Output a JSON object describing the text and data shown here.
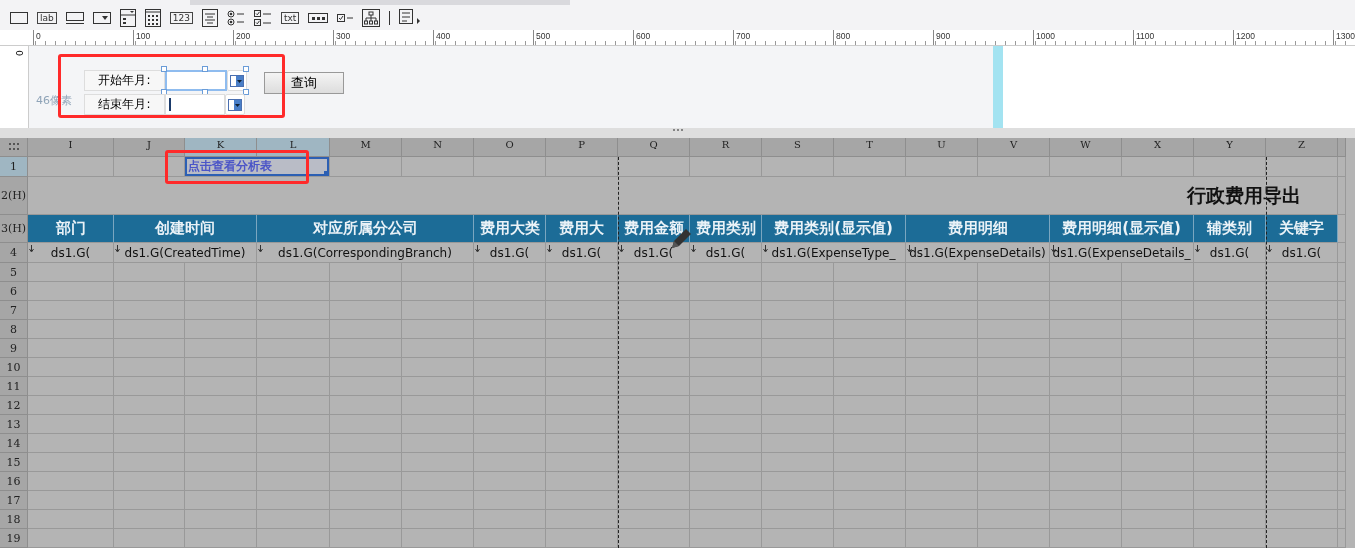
{
  "toolbar": [
    {
      "kind": "frame"
    },
    {
      "kind": "text",
      "text": "lab"
    },
    {
      "kind": "textbox"
    },
    {
      "kind": "combo"
    },
    {
      "kind": "list"
    },
    {
      "kind": "calendar"
    },
    {
      "kind": "text",
      "text": "123"
    },
    {
      "kind": "textarea"
    },
    {
      "kind": "radio"
    },
    {
      "kind": "checkgroup"
    },
    {
      "kind": "text",
      "text": "txt"
    },
    {
      "kind": "password"
    },
    {
      "kind": "checkbox"
    },
    {
      "kind": "tree"
    },
    {
      "kind": "separator"
    },
    {
      "kind": "more"
    }
  ],
  "ruler": {
    "ticks": [
      "0",
      "100",
      "200",
      "300",
      "400",
      "500",
      "600",
      "700",
      "800",
      "900",
      "1000",
      "1100",
      "1200",
      "1300"
    ],
    "vertical": "0"
  },
  "parameters": {
    "height_hint": "46像素",
    "button": "查询",
    "fields": [
      {
        "label": "开始年月:",
        "selected": true,
        "cursor": false
      },
      {
        "label": "结束年月:",
        "selected": false,
        "cursor": true
      }
    ]
  },
  "sheet": {
    "columns": [
      {
        "letter": "I",
        "selected": false,
        "page_break_after": false
      },
      {
        "letter": "J",
        "selected": false,
        "page_break_after": false
      },
      {
        "letter": "K",
        "selected": true,
        "page_break_after": false
      },
      {
        "letter": "L",
        "selected": true,
        "page_break_after": false
      },
      {
        "letter": "M",
        "selected": false,
        "page_break_after": false
      },
      {
        "letter": "N",
        "selected": false,
        "page_break_after": false
      },
      {
        "letter": "O",
        "selected": false,
        "page_break_after": false
      },
      {
        "letter": "P",
        "selected": false,
        "page_break_after": true
      },
      {
        "letter": "Q",
        "selected": false,
        "page_break_after": false
      },
      {
        "letter": "R",
        "selected": false,
        "page_break_after": false
      },
      {
        "letter": "S",
        "selected": false,
        "page_break_after": false
      },
      {
        "letter": "T",
        "selected": false,
        "page_break_after": false
      },
      {
        "letter": "U",
        "selected": false,
        "page_break_after": false
      },
      {
        "letter": "V",
        "selected": false,
        "page_break_after": false
      },
      {
        "letter": "W",
        "selected": false,
        "page_break_after": false
      },
      {
        "letter": "X",
        "selected": false,
        "page_break_after": false
      },
      {
        "letter": "Y",
        "selected": false,
        "page_break_after": true
      },
      {
        "letter": "Z",
        "selected": false,
        "page_break_after": false
      }
    ],
    "rows": [
      {
        "label": "1",
        "selected": true,
        "cells": [
          {
            "kind": "empty"
          },
          {
            "kind": "empty"
          },
          {
            "kind": "link",
            "text": "点击查看分析表",
            "selected": true
          },
          {
            "kind": "merged"
          }
        ]
      },
      {
        "label": "2(H)",
        "selected": false,
        "cells": [
          {
            "kind": "title",
            "text": "行政费用导出"
          },
          {
            "kind": "merged"
          },
          {
            "kind": "merged"
          },
          {
            "kind": "merged"
          },
          {
            "kind": "merged"
          },
          {
            "kind": "merged"
          },
          {
            "kind": "merged"
          },
          {
            "kind": "merged"
          },
          {
            "kind": "merged"
          },
          {
            "kind": "merged"
          },
          {
            "kind": "merged"
          },
          {
            "kind": "merged"
          },
          {
            "kind": "merged"
          },
          {
            "kind": "merged"
          },
          {
            "kind": "merged"
          },
          {
            "kind": "merged"
          },
          {
            "kind": "merged"
          },
          {
            "kind": "merged"
          }
        ]
      },
      {
        "label": "3(H)",
        "selected": false,
        "cells": [
          {
            "kind": "header",
            "text": "部门"
          },
          {
            "kind": "header",
            "text": "创建时间"
          },
          {
            "kind": "merged"
          },
          {
            "kind": "header",
            "text": "对应所属分公司"
          },
          {
            "kind": "merged"
          },
          {
            "kind": "merged"
          },
          {
            "kind": "header",
            "text": "费用大类"
          },
          {
            "kind": "header",
            "text": "费用大"
          },
          {
            "kind": "header",
            "text": "费用金额"
          },
          {
            "kind": "header",
            "text": "费用类别"
          },
          {
            "kind": "header",
            "text": "费用类别(显示值)"
          },
          {
            "kind": "merged"
          },
          {
            "kind": "header",
            "text": "费用明细"
          },
          {
            "kind": "merged"
          },
          {
            "kind": "header",
            "text": "费用明细(显示值)"
          },
          {
            "kind": "merged"
          },
          {
            "kind": "header",
            "text": "辅类别"
          },
          {
            "kind": "header",
            "text": "关键字"
          }
        ]
      },
      {
        "label": "4",
        "selected": false,
        "cells": [
          {
            "kind": "data",
            "text": "ds1.G("
          },
          {
            "kind": "data",
            "text": "ds1.G(CreatedTime)"
          },
          {
            "kind": "merged"
          },
          {
            "kind": "data",
            "text": "ds1.G(CorrespondingBranch)"
          },
          {
            "kind": "merged"
          },
          {
            "kind": "merged"
          },
          {
            "kind": "data",
            "text": "ds1.G("
          },
          {
            "kind": "data",
            "text": "ds1.G("
          },
          {
            "kind": "data",
            "text": "ds1.G("
          },
          {
            "kind": "data",
            "text": "ds1.G("
          },
          {
            "kind": "data",
            "text": "ds1.G(ExpenseType_"
          },
          {
            "kind": "merged"
          },
          {
            "kind": "data",
            "text": "ds1.G(ExpenseDetails)"
          },
          {
            "kind": "merged"
          },
          {
            "kind": "data",
            "text": "ds1.G(ExpenseDetails_"
          },
          {
            "kind": "merged"
          },
          {
            "kind": "data",
            "text": "ds1.G("
          },
          {
            "kind": "data",
            "text": "ds1.G("
          }
        ]
      },
      {
        "label": "5",
        "selected": false
      },
      {
        "label": "6",
        "selected": false
      },
      {
        "label": "7",
        "selected": false
      },
      {
        "label": "8",
        "selected": false
      },
      {
        "label": "9",
        "selected": false
      },
      {
        "label": "10",
        "selected": false
      },
      {
        "label": "11",
        "selected": false
      },
      {
        "label": "12",
        "selected": false
      },
      {
        "label": "13",
        "selected": false
      },
      {
        "label": "14",
        "selected": false
      },
      {
        "label": "15",
        "selected": false
      },
      {
        "label": "16",
        "selected": false
      },
      {
        "label": "17",
        "selected": false
      },
      {
        "label": "18",
        "selected": false
      },
      {
        "label": "19",
        "selected": false
      }
    ]
  }
}
